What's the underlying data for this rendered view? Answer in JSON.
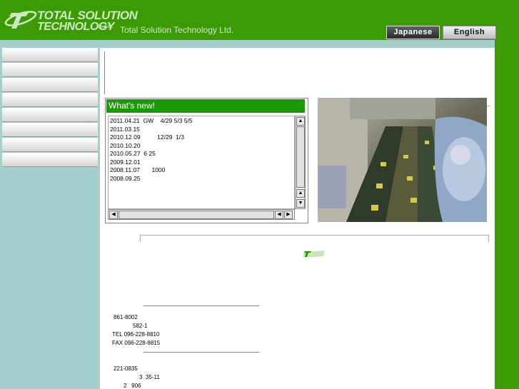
{
  "header": {
    "logo_line1": "TOTAL SOLUTION",
    "logo_line2": "TECHNOLOGY",
    "logo_suffix": "Co.,Ltd.",
    "company_name": "Total Solution Technology Ltd.",
    "lang_japanese": "Japanese",
    "lang_english": "English"
  },
  "news": {
    "title": "What's new!",
    "items": [
      "2011.04.21  GW    4/29 5/3 5/5",
      "2011.03.15",
      "2010.12.09          12/29  1/3",
      "2010.10.20",
      "2010.05.27  6 25",
      "2009.12.01",
      "2008.11.07       1000",
      "2008.09.25"
    ]
  },
  "address1": {
    "postal": "861-8002",
    "street": "582-1",
    "tel": "TEL 096-228-8810",
    "fax": "FAX 096-228-8815"
  },
  "address2": {
    "postal": "221-0835",
    "street": "3  35-11",
    "building": "2   906"
  },
  "colors": {
    "brand_green": "#3c9a05",
    "news_header": "#1b9905",
    "panel_teal": "#a5cfcc"
  }
}
